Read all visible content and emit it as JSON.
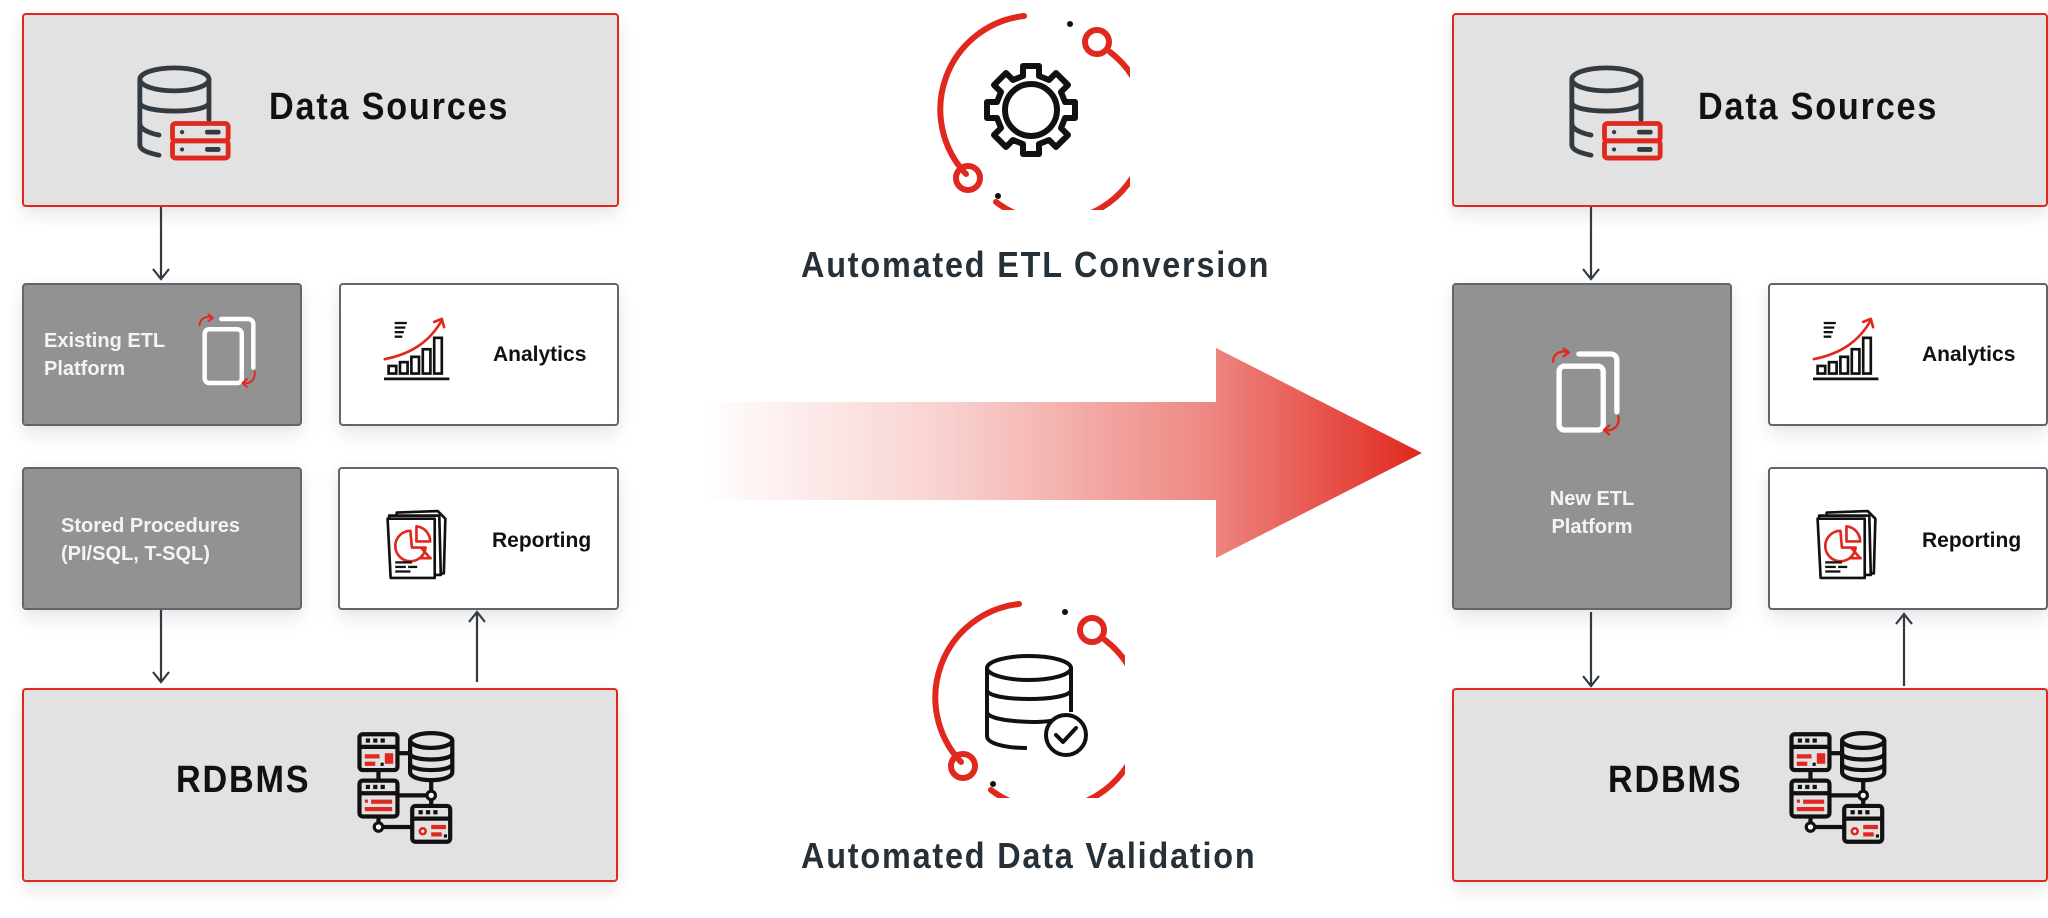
{
  "colors": {
    "accent_red": "#e0281e",
    "box_light": "#e2e2e2",
    "box_gray": "#929292",
    "outline": "#5e6770",
    "caption_text": "#263038"
  },
  "left": {
    "data_sources": "Data Sources",
    "existing_etl_line1": "Existing ETL",
    "existing_etl_line2": "Platform",
    "stored_procedures_line1": "Stored Procedures",
    "stored_procedures_line2": "(PI/SQL, T-SQL)",
    "analytics": "Analytics",
    "reporting": "Reporting",
    "rdbms": "RDBMS"
  },
  "center": {
    "etl_conversion": "Automated ETL Conversion",
    "data_validation": "Automated Data Validation"
  },
  "right": {
    "data_sources": "Data Sources",
    "new_etl_line1": "New ETL",
    "new_etl_line2": "Platform",
    "analytics": "Analytics",
    "reporting": "Reporting",
    "rdbms": "RDBMS"
  },
  "icons": {
    "data_sources": "database-server-icon",
    "etl_platform": "document-sync-icon",
    "analytics": "growth-chart-icon",
    "reporting": "report-pie-chart-icon",
    "rdbms": "database-network-icon",
    "etl_conversion": "gear-cycle-icon",
    "data_validation": "database-check-icon",
    "transition": "gradient-arrow-right-icon"
  }
}
